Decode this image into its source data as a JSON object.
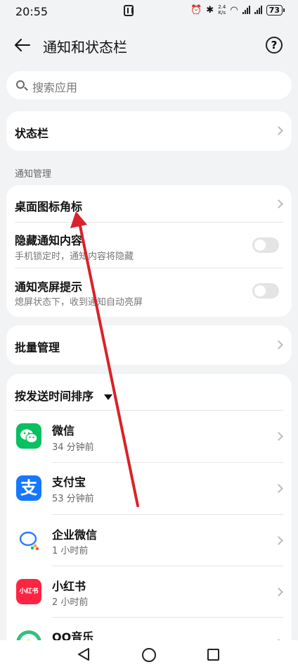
{
  "status_bar": {
    "time": "20:55",
    "network_speed_value": "2.4",
    "network_speed_unit": "K/s",
    "battery": "73"
  },
  "header": {
    "title": "通知和状态栏",
    "help_symbol": "?"
  },
  "search": {
    "placeholder": "搜索应用"
  },
  "status_bar_item": {
    "label": "状态栏"
  },
  "notification_section": {
    "label": "通知管理",
    "items": [
      {
        "title": "桌面图标角标"
      },
      {
        "title": "隐藏通知内容",
        "subtitle": "手机锁定时，通知内容将隐藏",
        "toggle_on": false
      },
      {
        "title": "通知亮屏提示",
        "subtitle": "熄屏状态下，收到通知自动亮屏",
        "toggle_on": false
      }
    ]
  },
  "batch": {
    "label": "批量管理"
  },
  "apps_section": {
    "sort_label": "按发送时间排序",
    "apps": [
      {
        "name": "微信",
        "time": "34 分钟前",
        "icon": "wechat-icon",
        "color": "#07c160"
      },
      {
        "name": "支付宝",
        "time": "53 分钟前",
        "icon": "alipay-icon",
        "color": "#1677ff"
      },
      {
        "name": "企业微信",
        "time": "1 小时前",
        "icon": "wecom-icon",
        "color": "#2b7cff"
      },
      {
        "name": "小红书",
        "time": "2 小时前",
        "icon": "xiaohongshu-icon",
        "icon_text": "小红书",
        "color": "#ff2442"
      },
      {
        "name": "QQ音乐",
        "time": "",
        "icon": "qqmusic-icon",
        "color": "#31c27c"
      }
    ]
  },
  "annotation": {
    "color": "#d9222a"
  }
}
